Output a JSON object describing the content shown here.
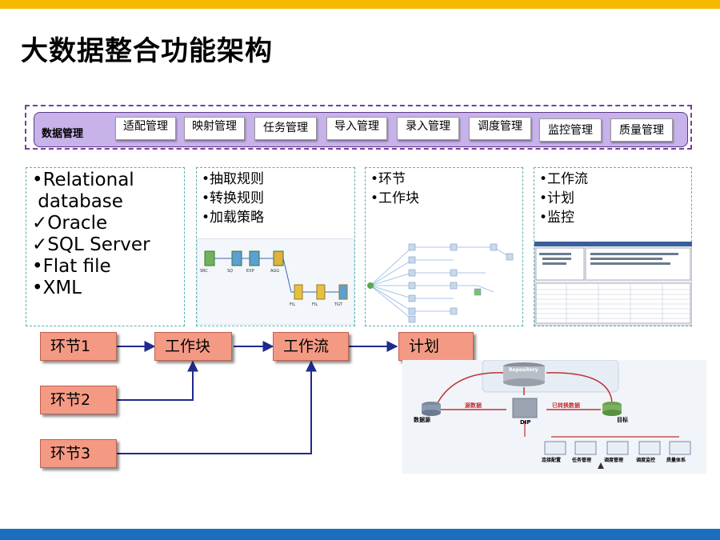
{
  "title": "大数据整合功能架构",
  "management": {
    "label": "数据管理",
    "items": [
      "适配管理",
      "映射管理",
      "任务管理",
      "导入管理",
      "录入管理",
      "调度管理",
      "监控管理",
      "质量管理"
    ]
  },
  "panels": {
    "sources": [
      "•Relational",
      " database",
      "✓Oracle",
      "✓SQL Server",
      "•Flat file",
      "•XML"
    ],
    "rules": [
      "•抽取规则",
      "•转换规则",
      "•加载策略"
    ],
    "blocks": [
      "•环节",
      "•工作块"
    ],
    "workflow": [
      "•工作流",
      "•计划",
      "•监控"
    ]
  },
  "flow": {
    "step1": "环节1",
    "step2": "环节2",
    "step3": "环节3",
    "block": "工作块",
    "workflow": "工作流",
    "plan": "计划"
  },
  "architecture": {
    "repository": "Repository",
    "source": "数据源",
    "source_data": "源数据",
    "dip": "DIP",
    "converted": "已转换数据",
    "target": "目标",
    "modules": [
      "连接配置",
      "任务管理",
      "调度管理",
      "调度监控",
      "质量体系"
    ]
  },
  "colors": {
    "top_bar": "#f7b800",
    "bottom_bar": "#1b6fc0",
    "flow_box": "#f49a84",
    "mgmt_bg": "#c7b2ea",
    "arrow": "#1f2a8c"
  }
}
